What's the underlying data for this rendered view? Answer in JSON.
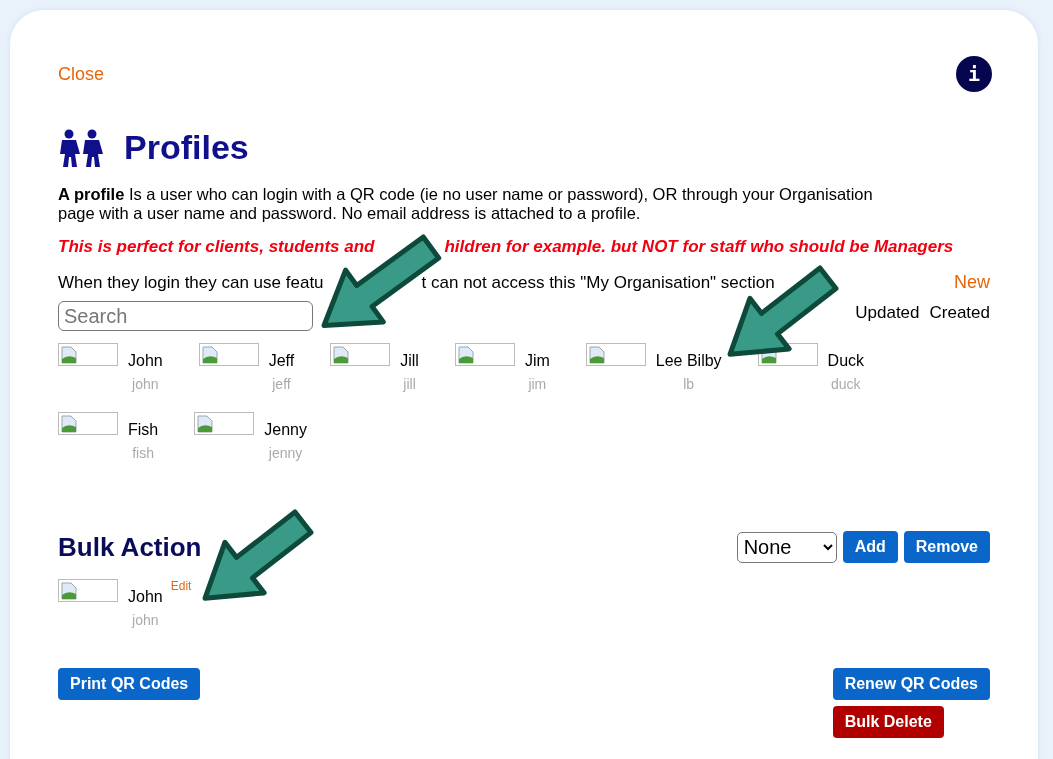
{
  "close": "Close",
  "info_button": "i",
  "title": "Profiles",
  "intro": "**A profile** Is a user who can login with a QR code (ie no user name or password), OR through your Organisation page with a user name and password. No email address is attached to a profile.",
  "notice_parts": [
    "This is perfect for clients, students and",
    "hildren for example. but NOT for staff who should be Managers"
  ],
  "login_parts": [
    "When they login they can use featu",
    "t can not access this \"My Organisation\" section"
  ],
  "new_link": "New",
  "search": {
    "placeholder": "Search"
  },
  "sort_options": [
    "Updated",
    "Created"
  ],
  "profiles": [
    {
      "name": "John",
      "username": "john"
    },
    {
      "name": "Jeff",
      "username": "jeff"
    },
    {
      "name": "Jill",
      "username": "jill"
    },
    {
      "name": "Jim",
      "username": "jim"
    },
    {
      "name": "Lee Bilby",
      "username": "lb"
    },
    {
      "name": "Duck",
      "username": "duck"
    },
    {
      "name": "Fish",
      "username": "fish"
    },
    {
      "name": "Jenny",
      "username": "jenny"
    }
  ],
  "bulk": {
    "title": "Bulk Action",
    "select": {
      "value": "None"
    },
    "buttons": [
      "Add",
      "Remove"
    ],
    "items": [
      {
        "name": "John",
        "username": "john",
        "edit": "Edit"
      }
    ]
  },
  "left_actions": [
    {
      "label": "Print QR Codes",
      "kind": "primary"
    }
  ],
  "right_actions": [
    {
      "label": "Renew QR Codes",
      "kind": "primary"
    },
    {
      "label": "Bulk Delete",
      "kind": "danger"
    }
  ]
}
